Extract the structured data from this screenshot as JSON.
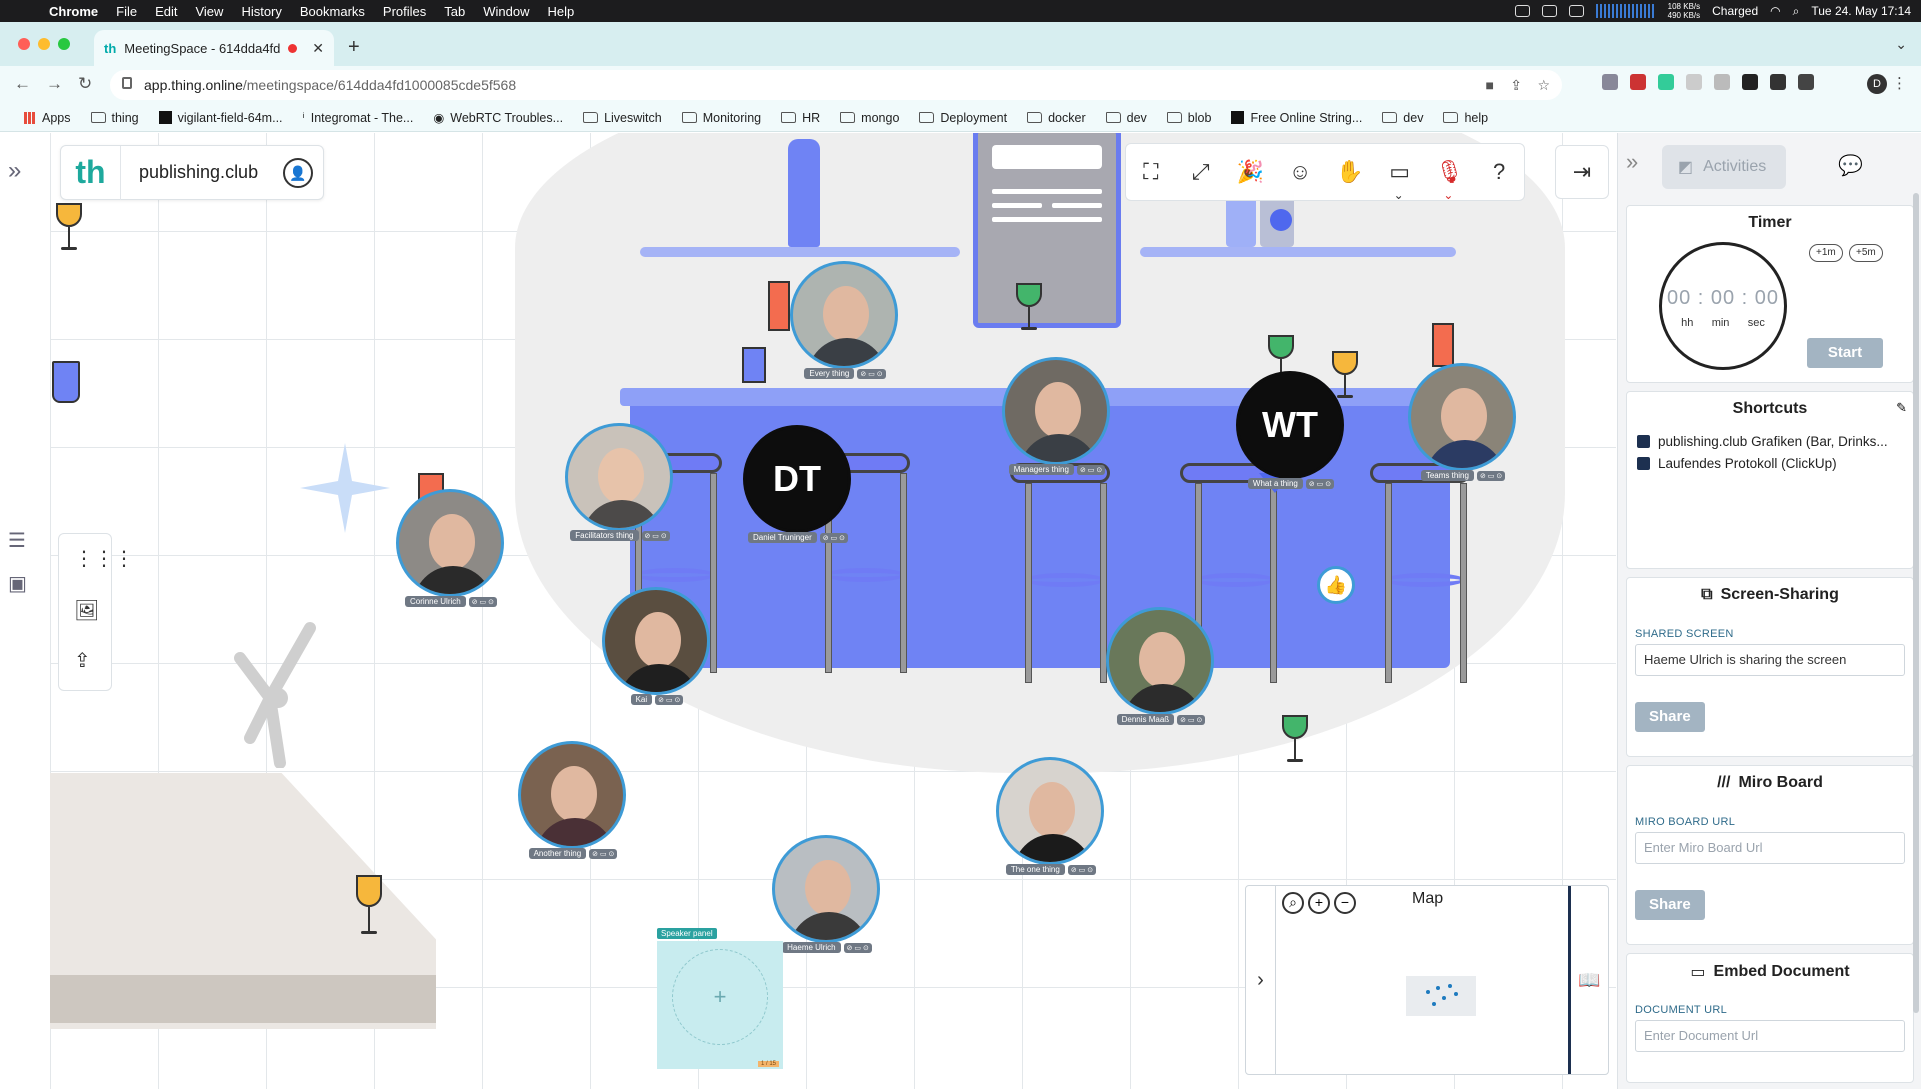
{
  "macos_menu": {
    "app": "Chrome",
    "items": [
      "File",
      "Edit",
      "View",
      "History",
      "Bookmarks",
      "Profiles",
      "Tab",
      "Window",
      "Help"
    ],
    "network_up": "108 KB/s",
    "network_down": "490 KB/s",
    "battery": "Charged",
    "clock": "Tue 24. May  17:14"
  },
  "browser": {
    "tab_title": "MeetingSpace - 614dda4fd",
    "url_host": "app.thing.online",
    "url_path": "/meetingspace/614dda4fd1000085cde5f568",
    "profile_initial": "D",
    "bookmarks": [
      "Apps",
      "thing",
      "vigilant-field-64m...",
      "Integromat - The...",
      "WebRTC Troubles...",
      "Liveswitch",
      "Monitoring",
      "HR",
      "mongo",
      "Deployment",
      "docker",
      "dev",
      "blob",
      "Free Online String...",
      "dev",
      "help"
    ]
  },
  "org": {
    "logo": "th",
    "name": "publishing.club"
  },
  "participants": [
    {
      "name": "Every thing",
      "status": "⊘ ▭ ⊙",
      "kind": "video"
    },
    {
      "name": "Facilitators thing",
      "status": "⊘ ▭ ⊙",
      "kind": "video"
    },
    {
      "name": "Daniel Truninger",
      "status": "⊘ ▭ ⊙",
      "kind": "initials",
      "initials": "DT"
    },
    {
      "name": "Managers thing",
      "status": "⊘ ▭ ⊙",
      "kind": "video"
    },
    {
      "name": "What a thing",
      "status": "⊘ ▭ ⊙",
      "kind": "initials",
      "initials": "WT"
    },
    {
      "name": "Teams thing",
      "status": "⊘ ▭ ⊙",
      "kind": "video"
    },
    {
      "name": "Corinne Ulrich",
      "status": "⊘ ▭ ⊙",
      "kind": "video"
    },
    {
      "name": "Kai",
      "status": "⊘ ▭ ⊙",
      "kind": "video"
    },
    {
      "name": "Dennis Maaß",
      "status": "⊘ ▭ ⊙",
      "kind": "video"
    },
    {
      "name": "Another thing",
      "status": "⊘ ▭ ⊙",
      "kind": "video"
    },
    {
      "name": "The one thing",
      "status": "⊘ ▭ ⊙",
      "kind": "video"
    },
    {
      "name": "Haeme Ulrich",
      "status": "⊘ ▭ ⊙",
      "kind": "video"
    }
  ],
  "speaker_panel": {
    "label": "Speaker panel",
    "tag": "1 / 15"
  },
  "map": {
    "title": "Map"
  },
  "sidebar": {
    "tab_activities": "Activities",
    "timer": {
      "title": "Timer",
      "display": "00 : 00 : 00",
      "units": [
        "hh",
        "min",
        "sec"
      ],
      "plus1": "+1m",
      "plus5": "+5m",
      "start": "Start"
    },
    "shortcuts": {
      "title": "Shortcuts",
      "items": [
        "publishing.club Grafiken (Bar, Drinks...",
        "Laufendes Protokoll (ClickUp)"
      ]
    },
    "screen_sharing": {
      "title": "Screen-Sharing",
      "label": "SHARED SCREEN",
      "value": "Haeme Ulrich is sharing the screen",
      "button": "Share"
    },
    "miro": {
      "title": "Miro Board",
      "label": "MIRO BOARD URL",
      "placeholder": "Enter Miro Board Url",
      "button": "Share"
    },
    "embed": {
      "title": "Embed Document",
      "label": "DOCUMENT URL",
      "placeholder": "Enter Document Url"
    }
  },
  "colors": {
    "accent": "#3e9bd6",
    "brand": "#1ea99d",
    "bar_blue": "#6f83f4"
  }
}
